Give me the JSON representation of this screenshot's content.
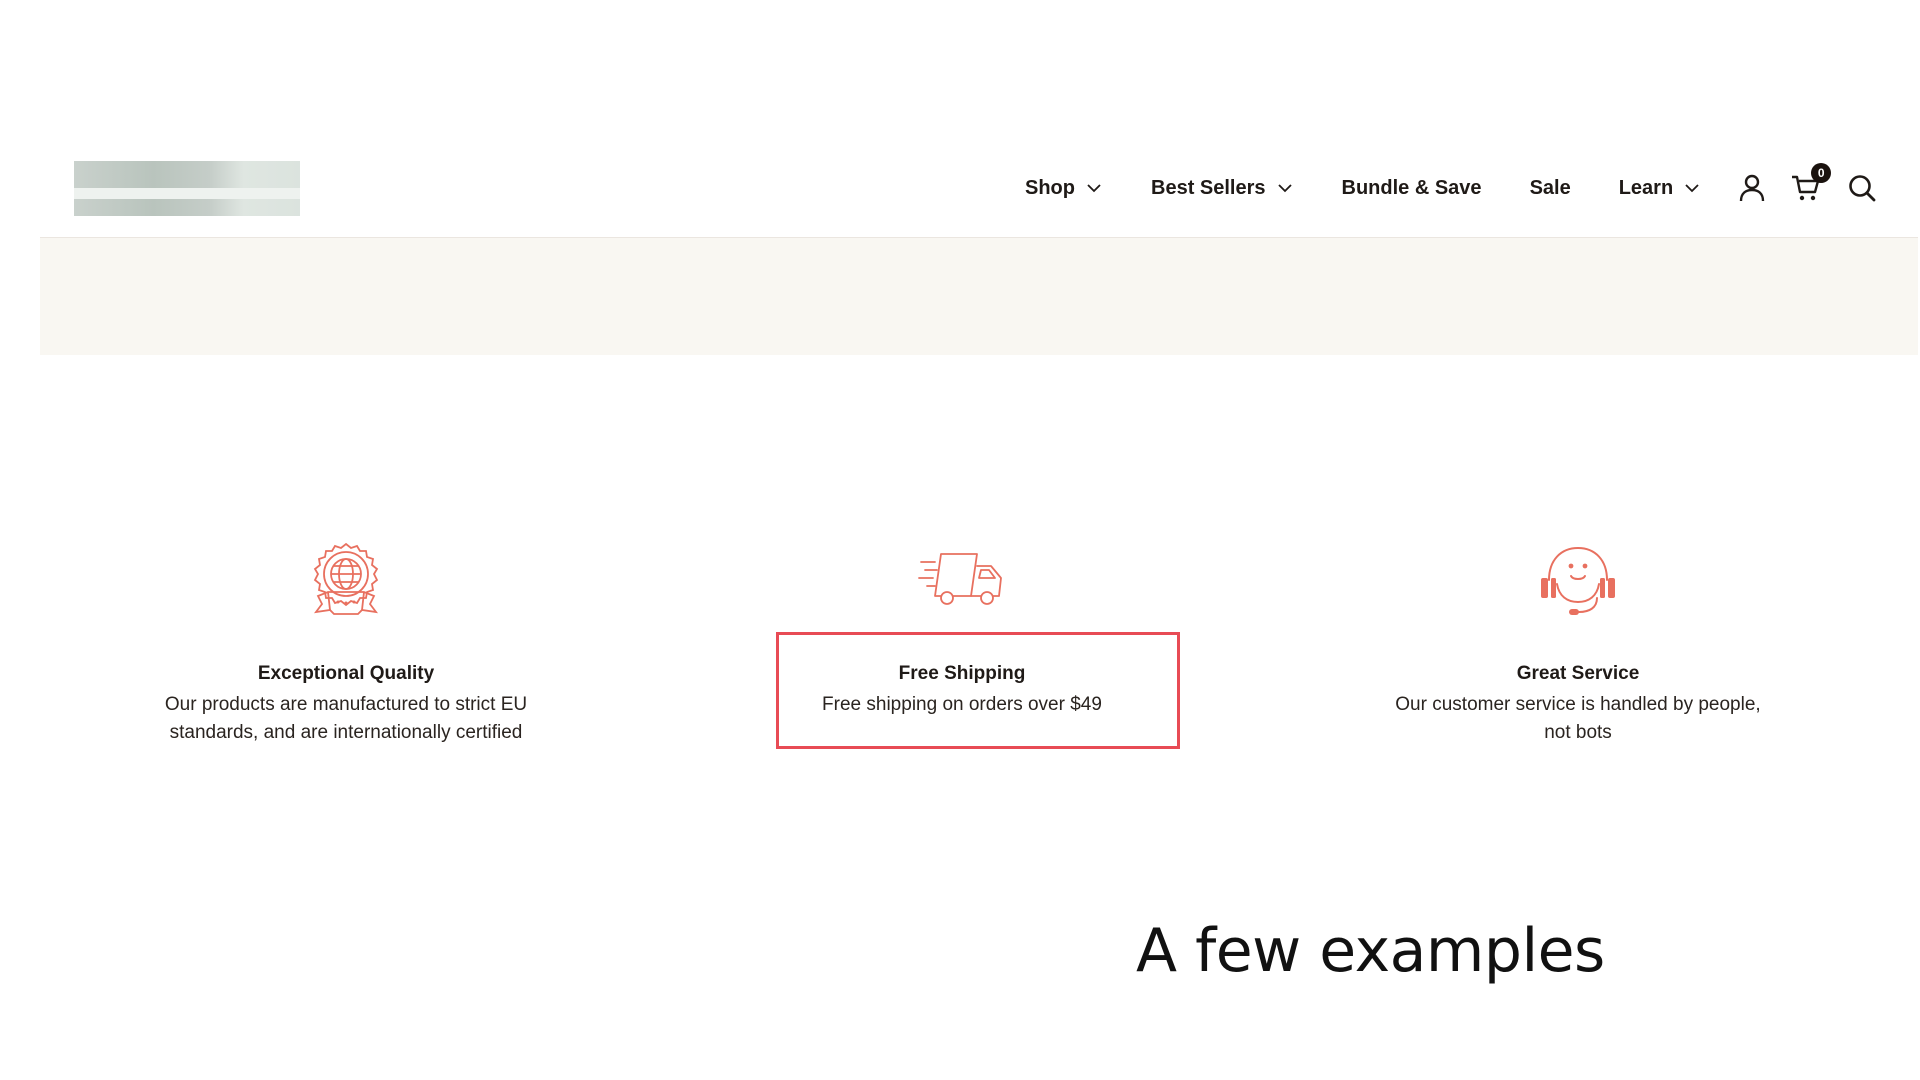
{
  "header": {
    "nav": [
      {
        "label": "Shop",
        "has_dropdown": true
      },
      {
        "label": "Best Sellers",
        "has_dropdown": true
      },
      {
        "label": "Bundle & Save",
        "has_dropdown": false
      },
      {
        "label": "Sale",
        "has_dropdown": false
      },
      {
        "label": "Learn",
        "has_dropdown": true
      }
    ],
    "icons": {
      "account": "user-icon",
      "cart": "cart-icon",
      "search": "search-icon"
    },
    "cart_count": "0"
  },
  "features": [
    {
      "icon": "quality-badge-icon",
      "title": "Exceptional Quality",
      "desc_line1": "Our products are manufactured to strict EU",
      "desc_line2": "standards, and are internationally certified"
    },
    {
      "icon": "delivery-truck-icon",
      "title": "Free Shipping",
      "desc_line1": "Free shipping on orders over $49",
      "desc_line2": ""
    },
    {
      "icon": "customer-service-headset-icon",
      "title": "Great Service",
      "desc_line1": "Our customer service is handled by people,",
      "desc_line2": "not bots"
    }
  ],
  "caption": "A few examples",
  "colors": {
    "accent": "#e8705f",
    "highlight_border": "#e84b55",
    "band": "#f9f7f2",
    "text": "#1f1a17"
  }
}
